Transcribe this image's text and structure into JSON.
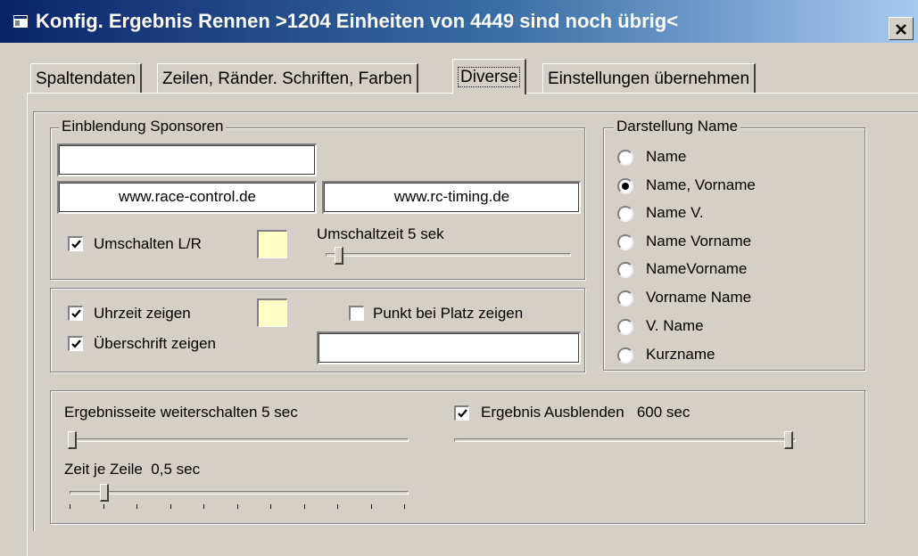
{
  "window": {
    "title": "Konfig. Ergebnis Rennen >1204 Einheiten von 4449 sind noch übrig<",
    "close_label": "✕",
    "app_icon": "window-icon"
  },
  "tabs": [
    {
      "label": "Spaltendaten",
      "active": false
    },
    {
      "label": "Zeilen, Ränder. Schriften, Farben",
      "active": false
    },
    {
      "label": "Diverse",
      "active": true
    },
    {
      "label": "Einstellungen übernehmen",
      "active": false
    }
  ],
  "sponsors": {
    "legend": "Einblendung Sponsoren",
    "field_top": "",
    "field_left": "www.race-control.de",
    "field_right": "www.rc-timing.de",
    "switch_lr": {
      "label": "Umschalten L/R",
      "checked": true
    },
    "switch_time_label": "Umschaltzeit 5 sek",
    "switch_time_value_sec": 5,
    "color": "#ffffc8"
  },
  "display": {
    "clock": {
      "label": "Uhrzeit zeigen",
      "checked": true
    },
    "clock_color": "#ffffc8",
    "point_at_place": {
      "label": "Punkt bei Platz zeigen",
      "checked": false
    },
    "headline": {
      "label": "Überschrift zeigen",
      "checked": true
    },
    "headline_text": ""
  },
  "name_format": {
    "legend": "Darstellung Name",
    "options": [
      {
        "label": "Name",
        "selected": false
      },
      {
        "label": "Name, Vorname",
        "selected": true
      },
      {
        "label": "Name V.",
        "selected": false
      },
      {
        "label": "Name Vorname",
        "selected": false
      },
      {
        "label": "NameVorname",
        "selected": false
      },
      {
        "label": "Vorname Name",
        "selected": false
      },
      {
        "label": "V. Name",
        "selected": false
      },
      {
        "label": "Kurzname",
        "selected": false
      }
    ]
  },
  "results": {
    "page_switch_label": "Ergebnisseite weiterschalten 5 sec",
    "page_switch_value_sec": 5,
    "hide_result": {
      "label": "Ergebnis Ausblenden   600 sec",
      "checked": true
    },
    "hide_result_value_sec": 600,
    "time_per_row_label": "Zeit je Zeile  0,5 sec",
    "time_per_row_value_sec": 0.5
  },
  "colors": {
    "titlebar_start": "#0a246a",
    "titlebar_end": "#a6caf0",
    "face": "#d4d0c8"
  }
}
